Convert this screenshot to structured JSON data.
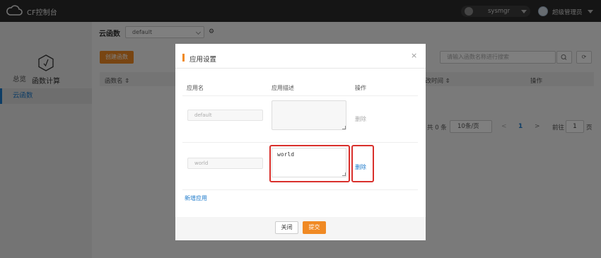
{
  "header": {
    "app_title": "CF控制台",
    "user_name": "sysmgr",
    "admin_name": "超级管理员"
  },
  "sidebar": {
    "title": "函数计算",
    "items": [
      {
        "label": "总览",
        "active": false
      },
      {
        "label": "云函数",
        "active": true
      }
    ]
  },
  "main": {
    "page_title": "云函数",
    "namespace_value": "default",
    "create_button": "创建函数",
    "search_placeholder": "请输入函数名称进行搜索",
    "columns": [
      "函数名 ⇕",
      "修改时间 ⇕",
      "操作"
    ],
    "pager": {
      "total": "共 0 条",
      "page_size": "10条/页",
      "prev": "<",
      "current_page": "1",
      "next": ">",
      "goto_label": "前往",
      "goto_value": "1",
      "unit": "页"
    }
  },
  "dialog": {
    "title": "应用设置",
    "close_icon": "×",
    "columns": {
      "name": "应用名",
      "description": "应用描述",
      "action": "操作"
    },
    "rows": [
      {
        "name": "default",
        "description": "",
        "action": "删除"
      },
      {
        "name": "world",
        "description": "world",
        "action": "删除"
      }
    ],
    "add_link": "新增应用",
    "close_button": "关闭",
    "submit_button": "提交"
  },
  "colors": {
    "accent_orange": "#f08a24",
    "link_blue": "#1d7acb",
    "highlight_red": "#d9302c",
    "topbar_bg": "#2b2b2b"
  }
}
